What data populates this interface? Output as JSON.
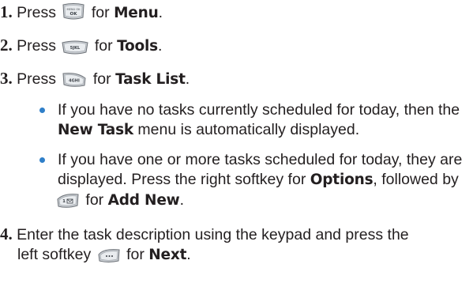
{
  "steps": [
    {
      "number": "1.",
      "before": "Press",
      "key_icon": "menu-ok-key",
      "after": "for",
      "bold": "Menu",
      "end": "."
    },
    {
      "number": "2.",
      "before": "Press",
      "key_icon": "5-jkl-key",
      "key_text": "5JKL",
      "after": "for",
      "bold": "Tools",
      "end": "."
    },
    {
      "number": "3.",
      "before": "Press",
      "key_icon": "4-ghi-key",
      "key_text": "4GHI",
      "after": "for",
      "bold": "Task List",
      "end": "."
    }
  ],
  "bullets": [
    {
      "line1": "If you have no tasks currently scheduled for today, then the",
      "line2_bold": "New Task",
      "line2_rest": " menu is automatically displayed."
    },
    {
      "line1": "If you have one or more tasks scheduled for today, they are",
      "line2_before": "displayed. Press the right softkey for ",
      "line2_bold": "Options",
      "line2_after": ", followed by",
      "line3_key_icon": "1-message-key",
      "line3_key_text": "1",
      "line3_text": "for",
      "line3_bold": "Add New",
      "line3_end": "."
    }
  ],
  "step4": {
    "number": "4.",
    "line1": "Enter the task description using the keypad and press the",
    "line2_before": "left softkey",
    "key_icon": "left-softkey",
    "line2_text": "for",
    "line2_bold": "Next",
    "line2_end": "."
  },
  "colors": {
    "text": "#231f20",
    "bullet": "#2f7fc9",
    "key_fill": "#c9cdd2"
  },
  "menu_key_label": "MENU OK"
}
